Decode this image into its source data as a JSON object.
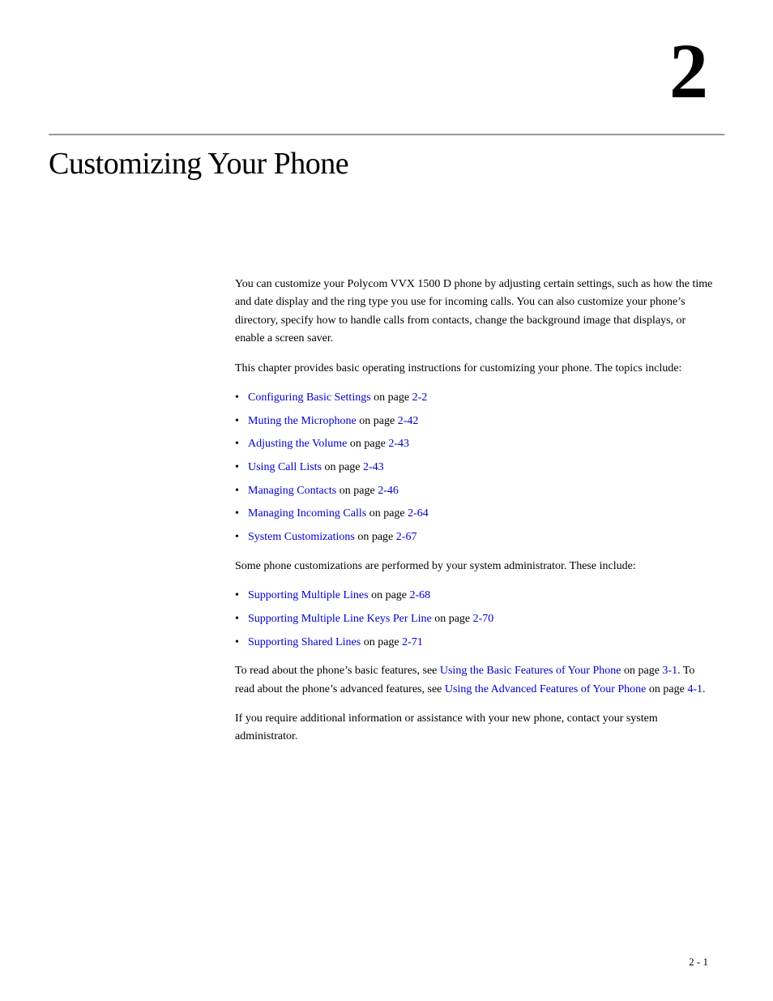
{
  "chapter": {
    "number": "2",
    "title": "Customizing Your Phone"
  },
  "content": {
    "intro_paragraph": "You can customize your Polycom VVX 1500 D phone by adjusting certain settings, such as how the time and date display and the ring type you use for incoming calls. You can also customize your phone’s directory, specify how to handle calls from contacts, change the background image that displays, or enable a screen saver.",
    "chapter_intro": "This chapter provides basic operating instructions for customizing your phone. The topics include:",
    "topics": [
      {
        "link_text": "Configuring Basic Settings",
        "suffix": " on page ",
        "page": "2-2"
      },
      {
        "link_text": "Muting the Microphone",
        "suffix": " on page ",
        "page": "2-42"
      },
      {
        "link_text": "Adjusting the Volume",
        "suffix": " on page ",
        "page": "2-43"
      },
      {
        "link_text": "Using Call Lists",
        "suffix": " on page ",
        "page": "2-43"
      },
      {
        "link_text": "Managing Contacts",
        "suffix": " on page ",
        "page": "2-46"
      },
      {
        "link_text": "Managing Incoming Calls",
        "suffix": " on page ",
        "page": "2-64"
      },
      {
        "link_text": "System Customizations",
        "suffix": " on page ",
        "page": "2-67"
      }
    ],
    "admin_paragraph": "Some phone customizations are performed by your system administrator. These include:",
    "admin_topics": [
      {
        "link_text": "Supporting Multiple Lines",
        "suffix": " on page ",
        "page": "2-68"
      },
      {
        "link_text": "Supporting Multiple Line Keys Per Line",
        "suffix": " on page ",
        "page": "2-70"
      },
      {
        "link_text": "Supporting Shared Lines",
        "suffix": " on page ",
        "page": "2-71"
      }
    ],
    "read_more_para_start": "To read about the phone’s basic features, see ",
    "read_more_link1": "Using the Basic Features of Your Phone",
    "read_more_mid1": " on page ",
    "read_more_page1": "3-1",
    "read_more_mid2": ". To read about the phone’s advanced features, see ",
    "read_more_link2": "Using the Advanced Features of Your Phone",
    "read_more_mid3": " on page ",
    "read_more_page2": "4-1",
    "read_more_end": ".",
    "assistance_paragraph": "If you require additional information or assistance with your new phone, contact your system administrator."
  },
  "page_number": "2 - 1"
}
